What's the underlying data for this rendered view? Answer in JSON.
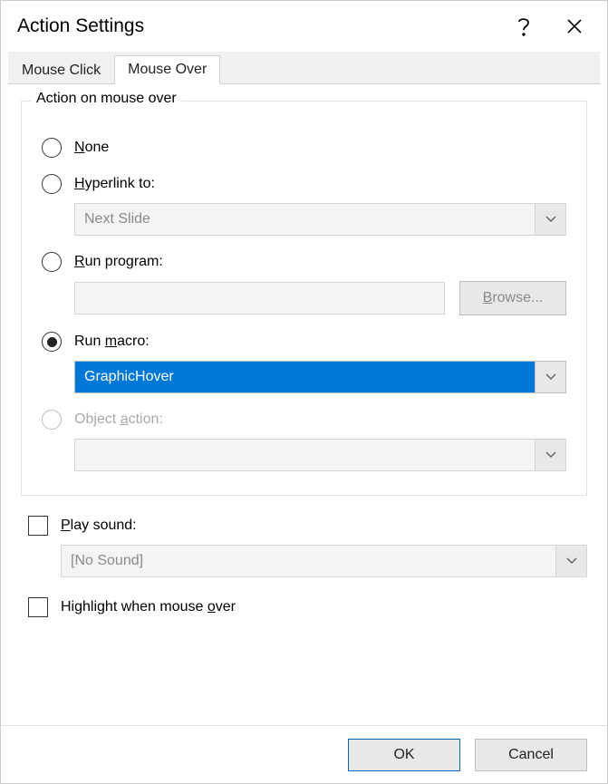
{
  "title": "Action Settings",
  "tabs": {
    "click": "Mouse Click",
    "over": "Mouse Over"
  },
  "group": {
    "legend": "Action on mouse over",
    "none": "None",
    "hyperlink": "Hyperlink to:",
    "hyperlink_value": "Next Slide",
    "runprogram": "Run program:",
    "browse": "Browse...",
    "runmacro": "Run macro:",
    "macro_value": "GraphicHover",
    "objectaction": "Object action:"
  },
  "playsound": "Play sound:",
  "sound_value": "[No Sound]",
  "highlight": "Highlight when mouse over",
  "buttons": {
    "ok": "OK",
    "cancel": "Cancel"
  }
}
